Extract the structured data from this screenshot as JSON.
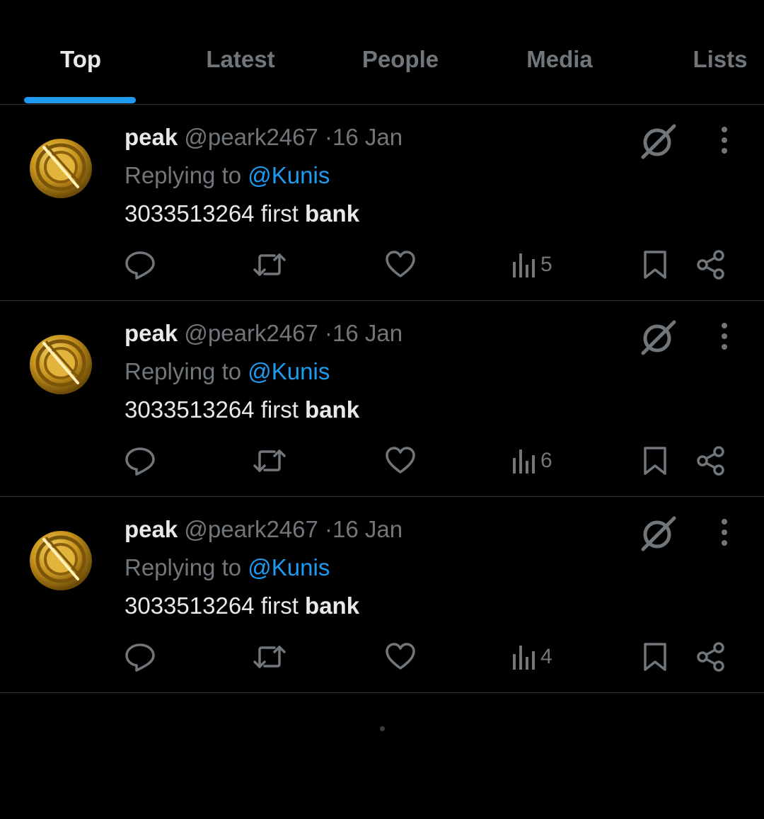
{
  "tabs": [
    {
      "label": "Top",
      "active": true
    },
    {
      "label": "Latest",
      "active": false
    },
    {
      "label": "People",
      "active": false
    },
    {
      "label": "Media",
      "active": false
    },
    {
      "label": "Lists",
      "active": false
    }
  ],
  "colors": {
    "accent": "#1d9bf0",
    "background": "#000000",
    "muted_text": "#71767b",
    "primary_text": "#e7e9ea"
  },
  "posts": [
    {
      "name": "peak",
      "handle": "@peark2467",
      "separator": "·",
      "date": "16 Jan",
      "replying_prefix": "Replying to",
      "replying_to": "@Kunis",
      "text_plain": "3033513264 first",
      "text_bold": "bank",
      "views": "5"
    },
    {
      "name": "peak",
      "handle": "@peark2467",
      "separator": "·",
      "date": "16 Jan",
      "replying_prefix": "Replying to",
      "replying_to": "@Kunis",
      "text_plain": "3033513264 first",
      "text_bold": "bank",
      "views": "6"
    },
    {
      "name": "peak",
      "handle": "@peark2467",
      "separator": "·",
      "date": "16 Jan",
      "replying_prefix": "Replying to",
      "replying_to": "@Kunis",
      "text_plain": "3033513264 first",
      "text_bold": "bank",
      "views": "4"
    }
  ],
  "icons": {
    "avatar": "gold-coin-avatar",
    "grok": "grok-icon",
    "more": "more-vertical-icon",
    "reply": "reply-icon",
    "repost": "repost-icon",
    "like": "heart-icon",
    "views": "views-icon",
    "bookmark": "bookmark-icon",
    "share": "share-icon"
  }
}
